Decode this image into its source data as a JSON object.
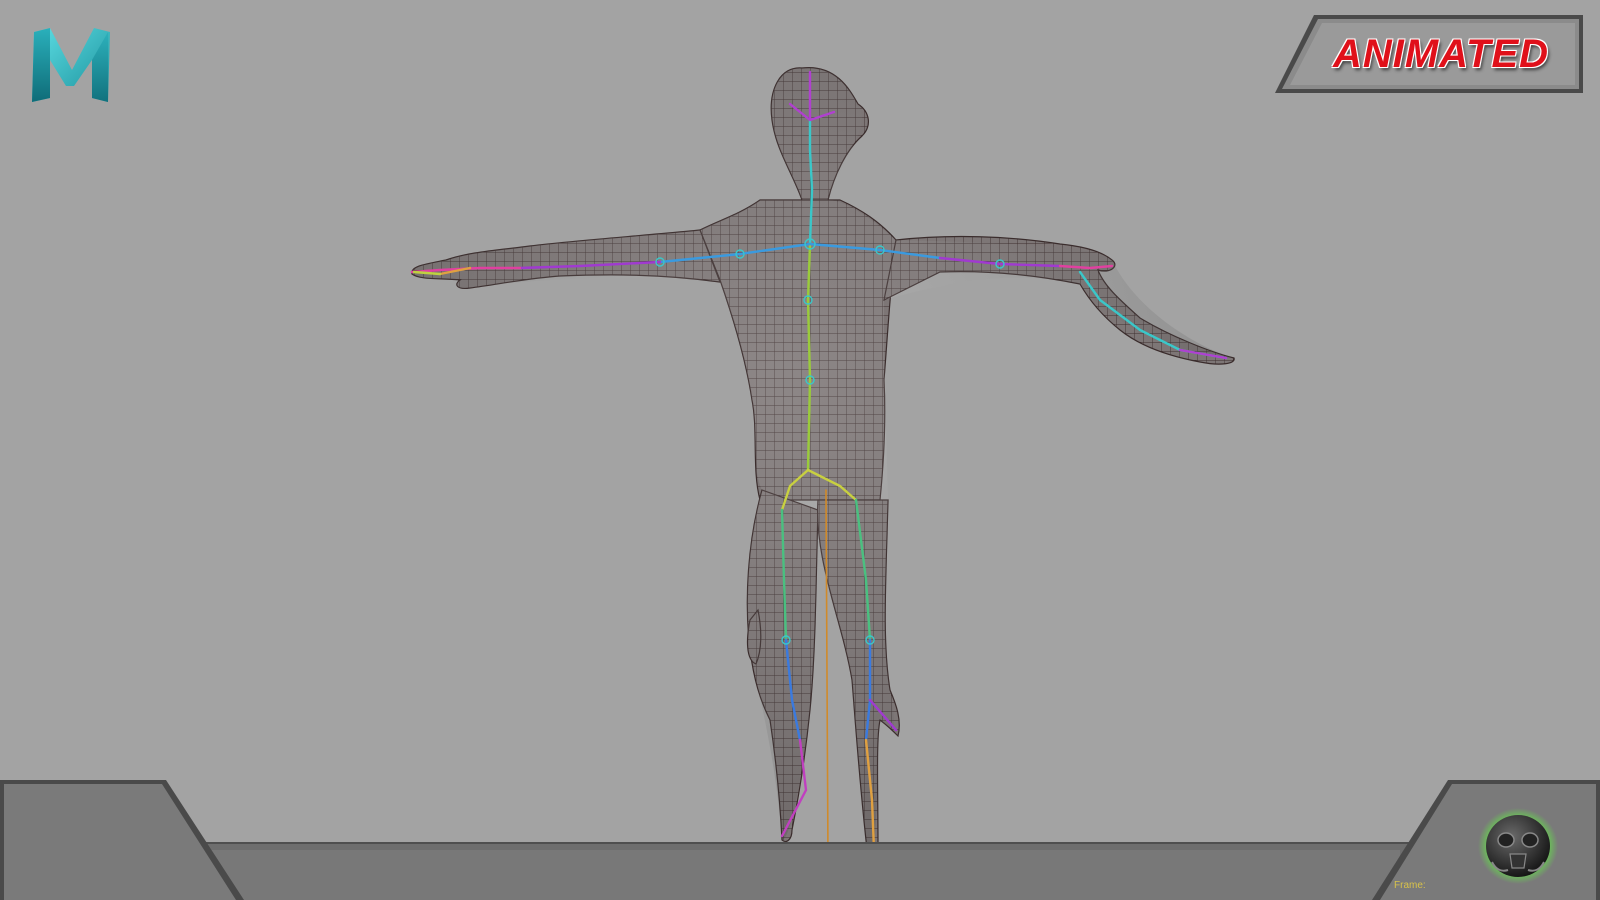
{
  "badge": {
    "label": "ANIMATED"
  },
  "bottom_bar": {
    "frame_label": "Frame:"
  },
  "icons": {
    "logo": "maya-logo-icon",
    "emblem": "gas-mask-emblem-icon"
  },
  "colors": {
    "background": "#a3a3a3",
    "badge_text": "#e0101a",
    "logo_teal": "#2fb7c0",
    "mesh_wire": "#4a3a3a",
    "frame_label": "#d8c24a",
    "emblem_glow": "#5dff3a"
  }
}
